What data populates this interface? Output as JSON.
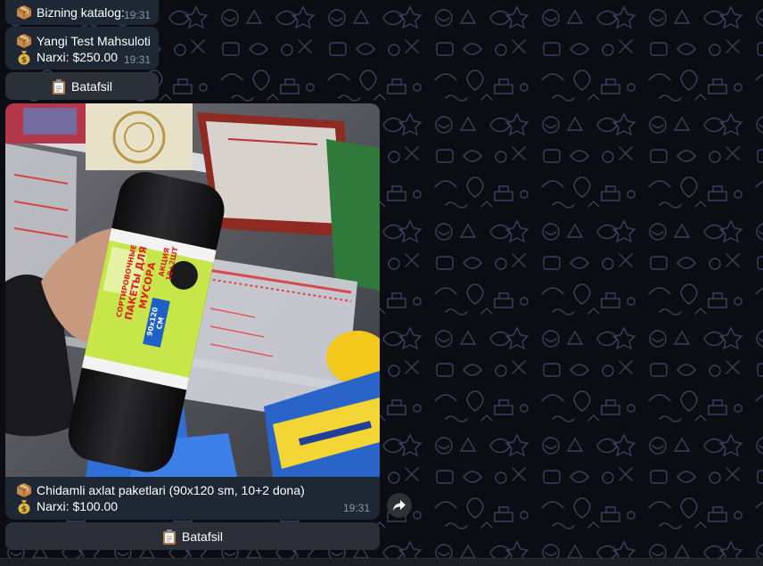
{
  "messages": [
    {
      "icon": "package-icon",
      "title": "Bizning katalog:",
      "time": "19:31"
    },
    {
      "icon": "package-icon",
      "title": "Yangi Test Mahsuloti",
      "price_icon": "money-bag-icon",
      "price": "Narxi: $250.00",
      "time": "19:31",
      "button": {
        "icon": "clipboard-icon",
        "label": "Batafsil"
      }
    },
    {
      "photo": {
        "package_text_1": "СОРТИРОВОЧНЫЕ",
        "package_text_2": "ПАКЕТЫ ДЛЯ МУСОРА",
        "package_size": "90x120 СМ",
        "package_promo": "АКЦИЯ 10+2ШТ"
      },
      "icon": "package-icon",
      "title": "Chidamli axlat paketlari (90x120 sm, 10+2 dona)",
      "price_icon": "money-bag-icon",
      "price": "Narxi: $100.00",
      "time": "19:31",
      "button": {
        "icon": "clipboard-icon",
        "label": "Batafsil"
      }
    }
  ],
  "share_icon": "share-arrow-icon",
  "colors": {
    "bubble": "#1e2734",
    "button": "#2b3038",
    "time": "#8a95a4",
    "background": "#0b0d12"
  }
}
